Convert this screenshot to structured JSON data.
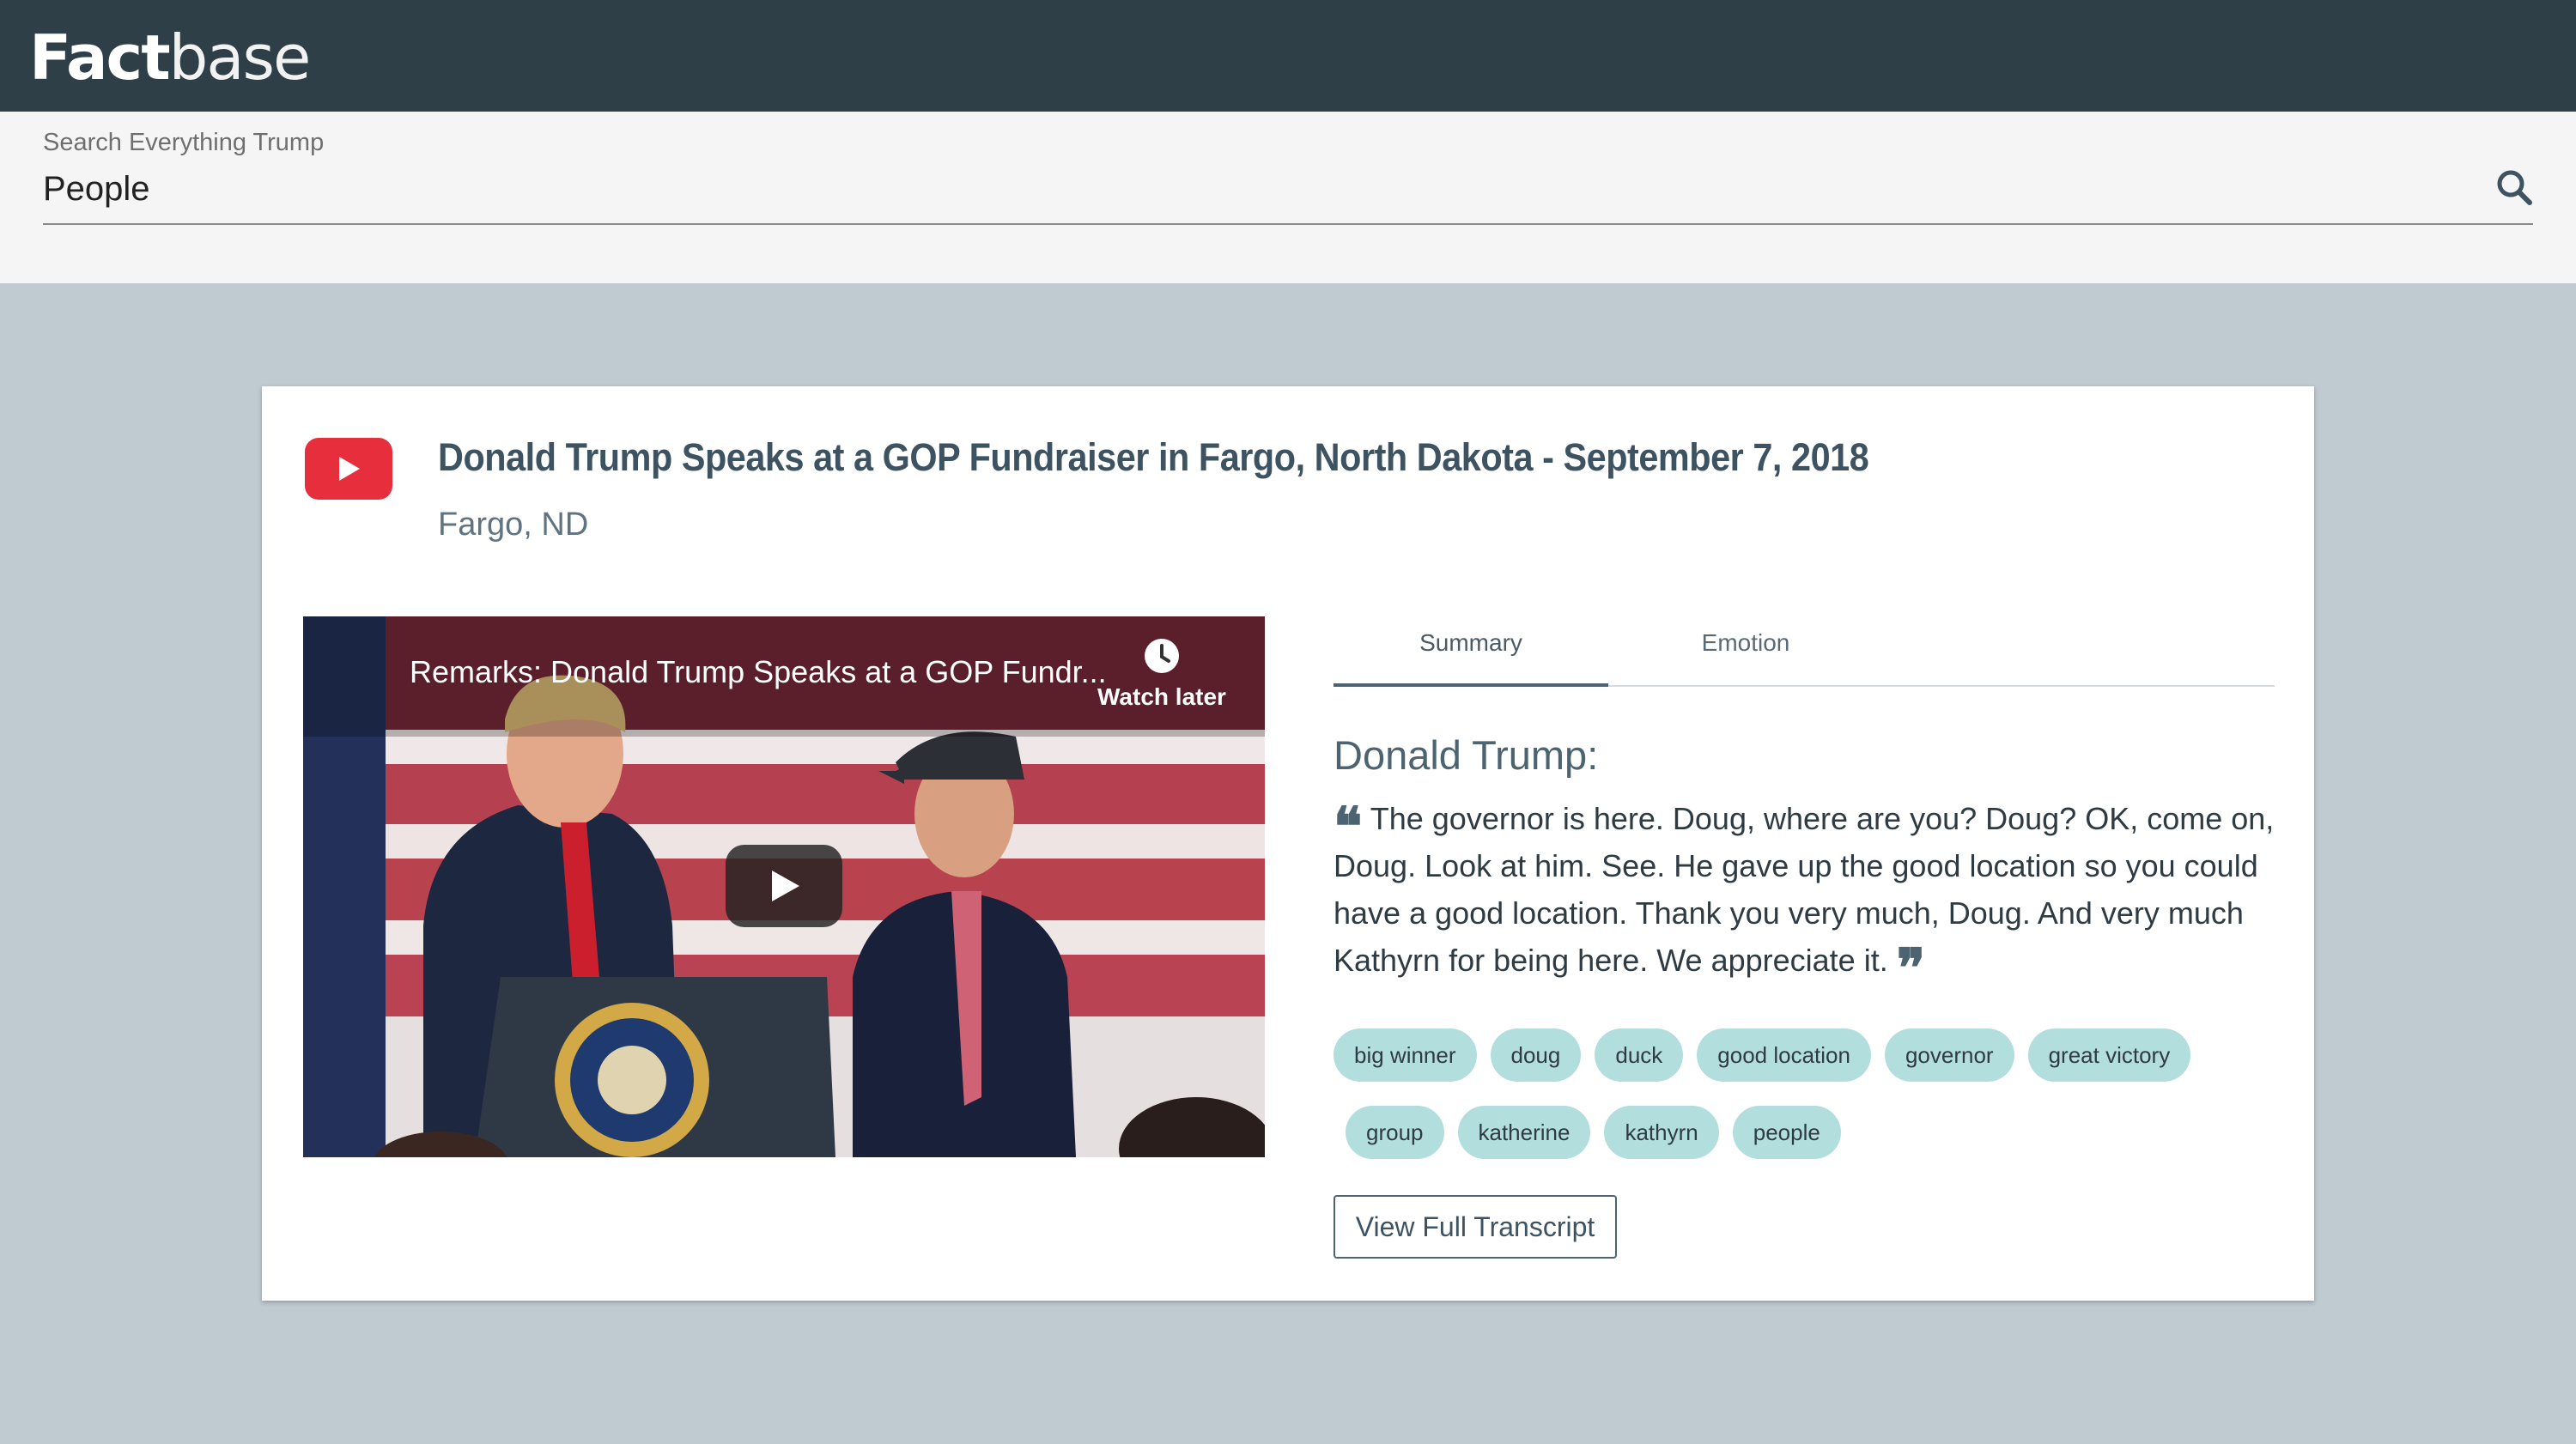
{
  "header": {
    "logo_bold": "Fact",
    "logo_light": "base"
  },
  "search": {
    "label": "Search Everything Trump",
    "value": "People"
  },
  "result": {
    "title": "Donald Trump Speaks at a GOP Fundraiser in Fargo, North Dakota - September 7, 2018",
    "location": "Fargo, ND",
    "video": {
      "title": "Remarks: Donald Trump Speaks at a GOP Fundr...",
      "watch_later": "Watch later"
    },
    "tabs": [
      {
        "label": "Summary"
      },
      {
        "label": "Emotion"
      }
    ],
    "speaker": "Donald Trump:",
    "quote": "The governor is here. Doug, where are you? Doug? OK, come on, Doug. Look at him. See. He gave up the good location so you could have a good location. Thank you very much, Doug. And very much Kathyrn for being here. We appreciate it.",
    "tags": [
      "big winner",
      "doug",
      "duck",
      "good location",
      "governor",
      "great victory",
      "group",
      "katherine",
      "kathyrn",
      "people"
    ],
    "transcript_button": "View Full Transcript"
  },
  "colors": {
    "topbar": "#2f3f47",
    "accent": "#4c6472",
    "tag_bg": "#b3dede",
    "youtube_red": "#e62e3c"
  },
  "icons": {
    "search": "search-icon",
    "video_provider": "youtube-icon",
    "watch_later": "clock-icon",
    "play": "play-icon"
  }
}
